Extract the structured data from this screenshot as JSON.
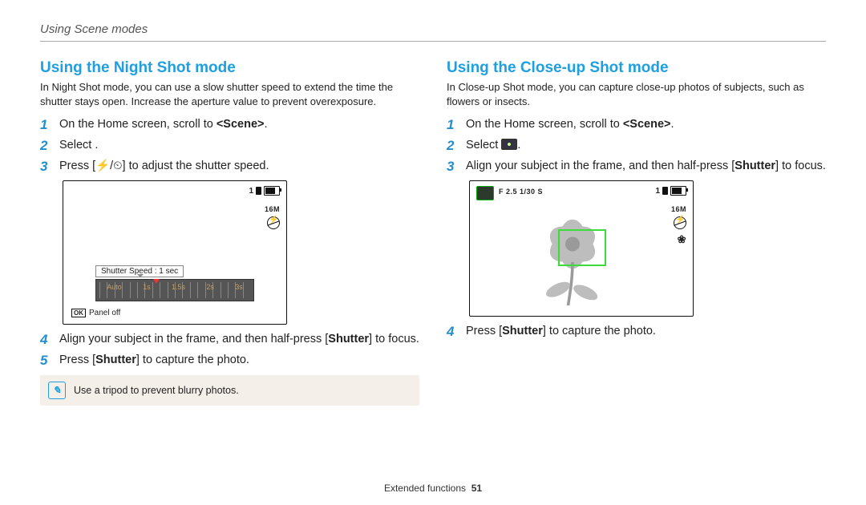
{
  "chapter": "Using Scene modes",
  "left": {
    "heading": "Using the Night Shot mode",
    "intro": "In Night Shot mode, you can use a slow shutter speed to extend the time the shutter stays open. Increase the aperture value to prevent overexposure.",
    "step1_pre": "On the Home screen, scroll to ",
    "step1_em": "<Scene>",
    "step1_post": ".",
    "step2": "Select        .",
    "step3_pre": "Press [",
    "step3_btn": "⚡/⏲",
    "step3_post": "] to adjust the shutter speed.",
    "slider_label": "Shutter Speed : 1 sec",
    "scale": {
      "a": "Auto",
      "b": "1s",
      "c": "1.5s",
      "d": "2s",
      "e": "3s"
    },
    "panel_ok": "OK",
    "panel_off": "Panel off",
    "res_label": "16M",
    "step4_pre": "Align your subject in the frame, and then half-press [",
    "step4_bold": "Shutter",
    "step4_post": "] to focus.",
    "step5_pre": "Press [",
    "step5_bold": "Shutter",
    "step5_post": "] to capture the photo.",
    "tip": "Use a tripod to prevent blurry photos."
  },
  "right": {
    "heading": "Using the Close-up Shot mode",
    "intro": "In Close-up Shot mode, you can capture close-up photos of subjects, such as flowers or insects.",
    "step1_pre": "On the Home screen, scroll to ",
    "step1_em": "<Scene>",
    "step1_post": ".",
    "step2_pre": "Select ",
    "step2_post": ".",
    "step3_pre": "Align your subject in the frame, and then half-press [",
    "step3_bold": "Shutter",
    "step3_post": "] to focus.",
    "exif": "F 2.5  1/30 S",
    "res_label": "16M",
    "step4_pre": "Press [",
    "step4_bold": "Shutter",
    "step4_post": "] to capture the photo."
  },
  "footer": {
    "section": "Extended functions",
    "page": "51"
  }
}
